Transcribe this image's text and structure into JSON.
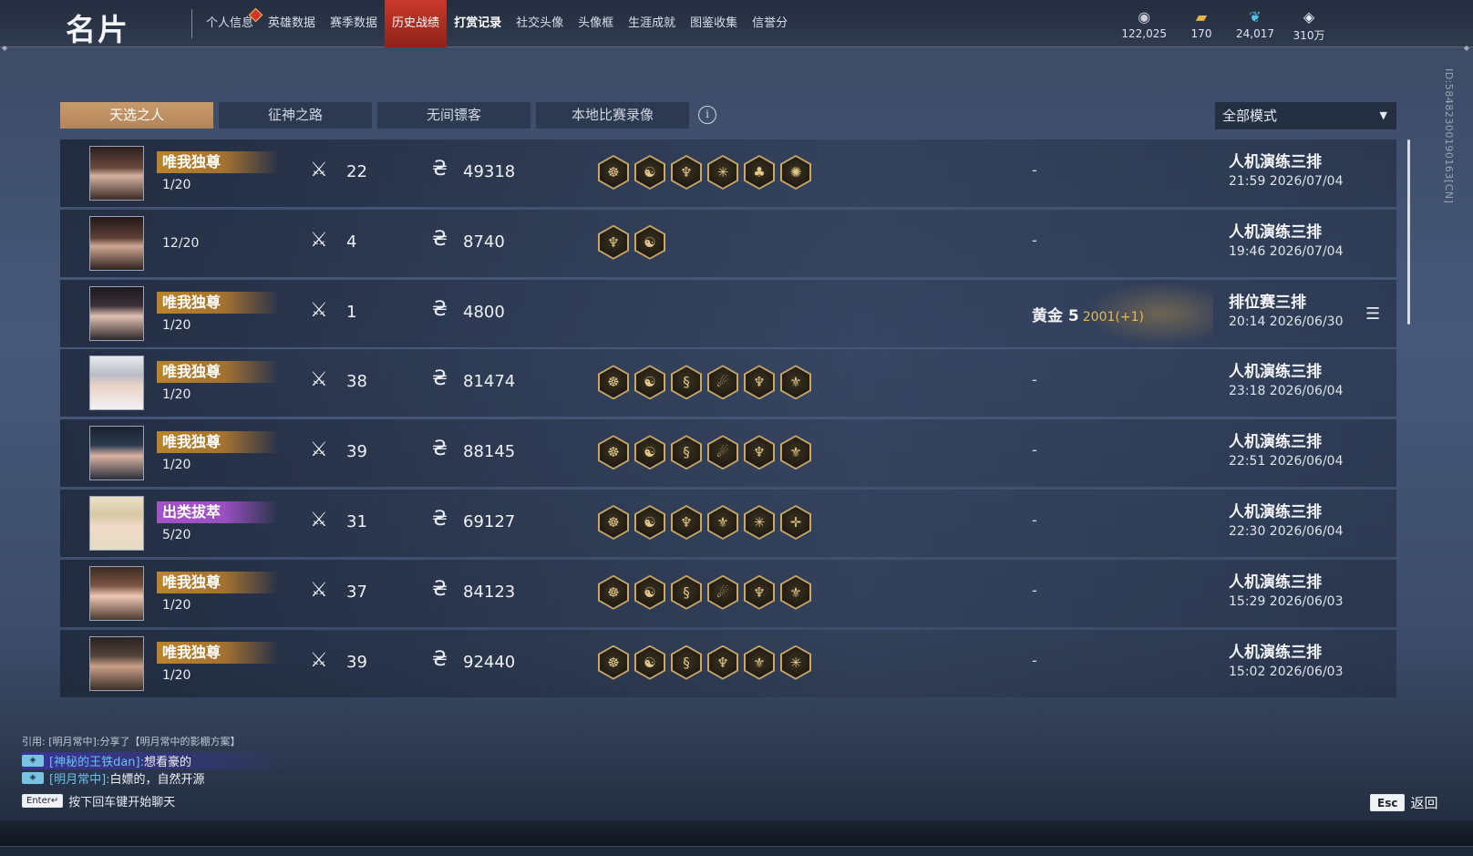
{
  "header": {
    "title": "名片",
    "nav": [
      {
        "label": "个人信息",
        "badge": true
      },
      {
        "label": "英雄数据"
      },
      {
        "label": "赛季数据"
      },
      {
        "label": "历史战绩",
        "active": true
      },
      {
        "label": "打赏记录",
        "bold": true
      },
      {
        "label": "社交头像"
      },
      {
        "label": "头像框"
      },
      {
        "label": "生涯成就"
      },
      {
        "label": "图鉴收集"
      },
      {
        "label": "信誉分"
      }
    ],
    "currencies": [
      {
        "icon": "coin-stack-icon",
        "value": "122,025"
      },
      {
        "icon": "ticket-icon",
        "value": "170"
      },
      {
        "icon": "feather-icon",
        "value": "24,017"
      },
      {
        "icon": "diamond-icon",
        "value": "310万"
      }
    ]
  },
  "side_id": "ID:5848230019016​3[CN]",
  "tabs": [
    "天选之人",
    "征神之路",
    "无间镖客",
    "本地比赛录像"
  ],
  "mode_filter": "全部模式",
  "matches": [
    {
      "title": "唯我独尊",
      "title_color": "gold",
      "placement": "1/20",
      "kills": "22",
      "coins": "49318",
      "items": [
        "☸",
        "☯",
        "♆",
        "✳",
        "♣",
        "✺"
      ],
      "rank": "-",
      "mode": "人机演练三排",
      "time": "21:59  2026/07/04"
    },
    {
      "title": "",
      "title_color": "",
      "placement": "12/20",
      "kills": "4",
      "coins": "8740",
      "items": [
        "♆",
        "☯"
      ],
      "rank": "-",
      "mode": "人机演练三排",
      "time": "19:46  2026/07/04"
    },
    {
      "title": "唯我独尊",
      "title_color": "gold",
      "placement": "1/20",
      "kills": "1",
      "coins": "4800",
      "items": [],
      "rank_label": "黄金 5",
      "rank_score": "2001(+1)",
      "mode": "排位赛三排",
      "time": "20:14  2026/06/30",
      "has_details": true
    },
    {
      "title": "唯我独尊",
      "title_color": "gold",
      "placement": "1/20",
      "kills": "38",
      "coins": "81474",
      "items": [
        "☸",
        "☯",
        "§",
        "☄",
        "♆",
        "⚜"
      ],
      "rank": "-",
      "mode": "人机演练三排",
      "time": "23:18  2026/06/04"
    },
    {
      "title": "唯我独尊",
      "title_color": "gold",
      "placement": "1/20",
      "kills": "39",
      "coins": "88145",
      "items": [
        "☸",
        "☯",
        "§",
        "☄",
        "♆",
        "⚜"
      ],
      "rank": "-",
      "mode": "人机演练三排",
      "time": "22:51  2026/06/04"
    },
    {
      "title": "出类拔萃",
      "title_color": "purple",
      "placement": "5/20",
      "kills": "31",
      "coins": "69127",
      "items": [
        "☸",
        "☯",
        "♆",
        "⚜",
        "✳",
        "✛"
      ],
      "rank": "-",
      "mode": "人机演练三排",
      "time": "22:30  2026/06/04"
    },
    {
      "title": "唯我独尊",
      "title_color": "gold",
      "placement": "1/20",
      "kills": "37",
      "coins": "84123",
      "items": [
        "☸",
        "☯",
        "§",
        "☄",
        "♆",
        "⚜"
      ],
      "rank": "-",
      "mode": "人机演练三排",
      "time": "15:29  2026/06/03"
    },
    {
      "title": "唯我独尊",
      "title_color": "gold",
      "placement": "1/20",
      "kills": "39",
      "coins": "92440",
      "items": [
        "☸",
        "☯",
        "§",
        "♆",
        "⚜",
        "✳"
      ],
      "rank": "-",
      "mode": "人机演练三排",
      "time": "15:02  2026/06/03"
    }
  ],
  "chat": {
    "quote": "引用: [明月常中]:分享了【明月常中的影棚方案】",
    "lines": [
      {
        "name": "[神秘的王铁dan]:",
        "msg": "想看豪的",
        "highlight": true
      },
      {
        "name": "[明月常中]:",
        "msg": "白嫖的，自然开源",
        "highlight": false
      }
    ],
    "enter_key": "Enter↵",
    "enter_hint": "按下回车键开始聊天"
  },
  "esc": {
    "key": "Esc",
    "label": "返回"
  },
  "colors": {
    "gold_badge": "#b8842c",
    "purple_badge": "#a253c4",
    "active_tab": "#c79a6a",
    "active_nav": "#c8392b",
    "rank_score": "#e3b955"
  }
}
